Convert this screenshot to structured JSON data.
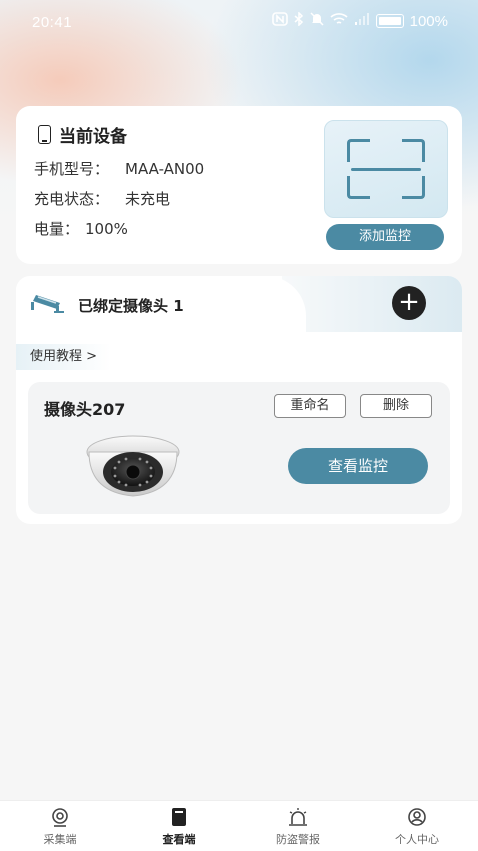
{
  "status_bar": {
    "time": "20:41",
    "nfc_icon": "nfc-icon",
    "bluetooth_icon": "bluetooth-icon",
    "mute_icon": "bell-off-icon",
    "wifi_icon": "wifi-icon",
    "signal_icon": "signal-icon",
    "battery_percent": "100%"
  },
  "device_card": {
    "title": "当前设备",
    "model_label": "手机型号：",
    "model_value": "MAA-AN00",
    "charge_label": "充电状态：",
    "charge_value": "未充电",
    "battery_label": "电量：",
    "battery_value": "100%",
    "scan_icon": "scan-frame-icon",
    "add_monitor_label": "添加监控"
  },
  "camera_panel": {
    "bound_text": "已绑定摄像头 1",
    "add_button": "+",
    "tutorial_link": "使用教程 >",
    "cameras": [
      {
        "name": "摄像头207",
        "rename_label": "重命名",
        "delete_label": "删除",
        "view_label": "查看监控"
      }
    ]
  },
  "tabbar": {
    "tabs": [
      {
        "label": "采集端",
        "icon": "webcam-icon"
      },
      {
        "label": "查看端",
        "icon": "phone-screen-icon"
      },
      {
        "label": "防盗警报",
        "icon": "alarm-light-icon"
      },
      {
        "label": "个人中心",
        "icon": "user-circle-icon"
      }
    ],
    "active": "查看端"
  },
  "colors": {
    "accent": "#4b8aa3",
    "dark": "#222222",
    "background": "#f6f6f6"
  }
}
